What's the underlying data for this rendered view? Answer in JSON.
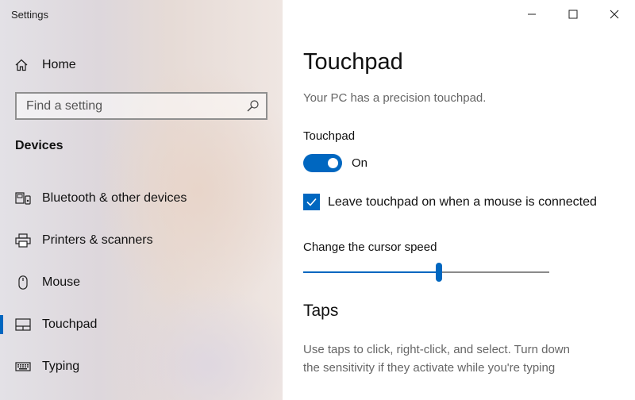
{
  "app": {
    "title": "Settings"
  },
  "sidebar": {
    "home": {
      "label": "Home",
      "icon": "home-icon"
    },
    "search": {
      "placeholder": "Find a setting",
      "value": "",
      "icon": "search-icon"
    },
    "section_title": "Devices",
    "items": [
      {
        "label": "Bluetooth & other devices",
        "icon": "bluetooth-devices-icon",
        "selected": false
      },
      {
        "label": "Printers & scanners",
        "icon": "printer-icon",
        "selected": false
      },
      {
        "label": "Mouse",
        "icon": "mouse-icon",
        "selected": false
      },
      {
        "label": "Touchpad",
        "icon": "touchpad-icon",
        "selected": true
      },
      {
        "label": "Typing",
        "icon": "keyboard-icon",
        "selected": false
      }
    ]
  },
  "window_controls": [
    "minimize-icon",
    "maximize-icon",
    "close-icon"
  ],
  "main": {
    "title": "Touchpad",
    "subtitle": "Your PC has a precision touchpad.",
    "touchpad_toggle": {
      "label": "Touchpad",
      "state_text": "On",
      "on": true
    },
    "leave_on_checkbox": {
      "label": "Leave touchpad on when a mouse is connected",
      "checked": true
    },
    "cursor_speed": {
      "label": "Change the cursor speed",
      "value": 0.55
    },
    "taps": {
      "title": "Taps",
      "description_line1": "Use taps to click, right-click, and select. Turn down",
      "description_line2": "the sensitivity if they activate while you're typing"
    }
  },
  "colors": {
    "accent": "#0067c0"
  }
}
